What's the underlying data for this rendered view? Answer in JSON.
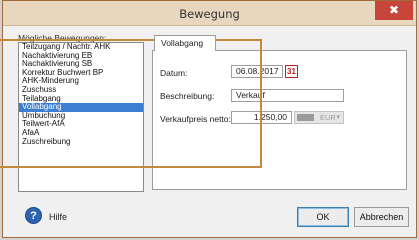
{
  "window": {
    "title": "Bewegung",
    "close_glyph": "✖"
  },
  "movements": {
    "label": "Mögliche Bewegungen:",
    "items": [
      "Teilzugang / Nachtr. AHK",
      "Nachaktivierung EB",
      "Nachaktivierung SB",
      "Korrektur Buchwert BP",
      "AHK-Minderung",
      "Zuschuss",
      "Teilabgang",
      "Vollabgang",
      "Umbuchung",
      "Teilwert-AfA",
      "AfaA",
      "Zuschreibung"
    ],
    "selected_index": 7
  },
  "tab": {
    "label": "Vollabgang"
  },
  "form": {
    "date_label": "Datum:",
    "date_value": "06.08.2017",
    "calendar_glyph": "31",
    "desc_label": "Beschreibung:",
    "desc_value": "Verkauf",
    "price_label": "Verkaufpreis netto:",
    "price_value": "1.250,00",
    "currency_value": "EUR",
    "currency_caret": "▾"
  },
  "footer": {
    "help_glyph": "?",
    "help_label": "Hilfe",
    "ok_label": "OK",
    "cancel_label": "Abbrechen"
  },
  "colors": {
    "selection": "#3b7fd2",
    "titlebar": "#e8d6bf",
    "close_button": "#c8453c",
    "highlight_frame": "#c4893a"
  }
}
